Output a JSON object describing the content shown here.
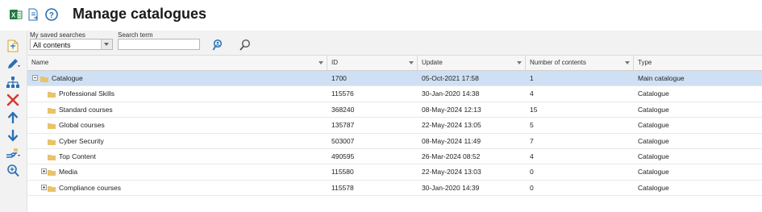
{
  "header": {
    "title": "Manage catalogues",
    "icons": [
      "excel-export-icon",
      "export-document-icon",
      "help-icon"
    ]
  },
  "filters": {
    "saved_searches_label": "My saved searches",
    "saved_searches_value": "All contents",
    "search_term_label": "Search term",
    "search_term_value": "",
    "icons": [
      "search-person-icon",
      "search-icon"
    ]
  },
  "left_toolbar": {
    "icons": [
      "new-document-icon",
      "edit-pencil-icon",
      "hierarchy-icon",
      "delete-icon",
      "move-up-icon",
      "move-down-icon",
      "share-hand-icon",
      "zoom-search-icon"
    ]
  },
  "table": {
    "columns": [
      {
        "label": "Name"
      },
      {
        "label": "ID"
      },
      {
        "label": "Update"
      },
      {
        "label": "Number of contents"
      },
      {
        "label": "Type"
      }
    ],
    "rows": [
      {
        "name": "Catalogue",
        "id": "1700",
        "update": "05-Oct-2021 17:58",
        "count": "1",
        "type": "Main catalogue",
        "level": 0,
        "expander": "minus",
        "selected": true
      },
      {
        "name": "Professional Skills",
        "id": "115576",
        "update": "30-Jan-2020 14:38",
        "count": "4",
        "type": "Catalogue",
        "level": 1,
        "expander": "none",
        "selected": false
      },
      {
        "name": "Standard courses",
        "id": "368240",
        "update": "08-May-2024 12:13",
        "count": "15",
        "type": "Catalogue",
        "level": 1,
        "expander": "none",
        "selected": false
      },
      {
        "name": "Global courses",
        "id": "135787",
        "update": "22-May-2024 13:05",
        "count": "5",
        "type": "Catalogue",
        "level": 1,
        "expander": "none",
        "selected": false
      },
      {
        "name": "Cyber Security",
        "id": "503007",
        "update": "08-May-2024 11:49",
        "count": "7",
        "type": "Catalogue",
        "level": 1,
        "expander": "none",
        "selected": false
      },
      {
        "name": "Top Content",
        "id": "490595",
        "update": "26-Mar-2024 08:52",
        "count": "4",
        "type": "Catalogue",
        "level": 1,
        "expander": "none",
        "selected": false
      },
      {
        "name": "Media",
        "id": "115580",
        "update": "22-May-2024 13:03",
        "count": "0",
        "type": "Catalogue",
        "level": 1,
        "expander": "plus",
        "selected": false
      },
      {
        "name": "Compliance courses",
        "id": "115578",
        "update": "30-Jan-2020 14:39",
        "count": "0",
        "type": "Catalogue",
        "level": 1,
        "expander": "plus",
        "selected": false
      }
    ]
  },
  "colors": {
    "selected_row": "#cfe0f4",
    "folder": "#e8c36a",
    "delete": "#d9342b",
    "accent_blue": "#2a6fb5"
  }
}
